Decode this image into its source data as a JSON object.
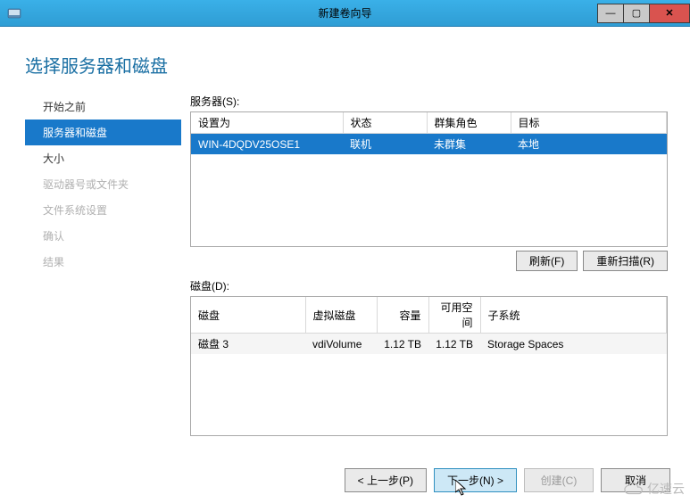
{
  "title": "新建卷向导",
  "heading": "选择服务器和磁盘",
  "nav": {
    "items": [
      {
        "label": "开始之前",
        "state": "normal"
      },
      {
        "label": "服务器和磁盘",
        "state": "selected"
      },
      {
        "label": "大小",
        "state": "normal"
      },
      {
        "label": "驱动器号或文件夹",
        "state": "disabled"
      },
      {
        "label": "文件系统设置",
        "state": "disabled"
      },
      {
        "label": "确认",
        "state": "disabled"
      },
      {
        "label": "结果",
        "state": "disabled"
      }
    ]
  },
  "servers": {
    "label": "服务器(S):",
    "columns": [
      "设置为",
      "状态",
      "群集角色",
      "目标"
    ],
    "rows": [
      {
        "cells": [
          "WIN-4DQDV25OSE1",
          "联机",
          "未群集",
          "本地"
        ],
        "selected": true
      }
    ]
  },
  "actions": {
    "refresh": "刷新(F)",
    "rescan": "重新扫描(R)"
  },
  "disks": {
    "label": "磁盘(D):",
    "columns": [
      "磁盘",
      "虚拟磁盘",
      "容量",
      "可用空间",
      "子系统"
    ],
    "rows": [
      {
        "cells": [
          "磁盘 3",
          "vdiVolume",
          "1.12 TB",
          "1.12 TB",
          "Storage Spaces"
        ]
      }
    ]
  },
  "footer": {
    "prev": "< 上一步(P)",
    "next": "下一步(N) >",
    "create": "创建(C)",
    "cancel": "取消"
  },
  "watermark": "亿速云"
}
